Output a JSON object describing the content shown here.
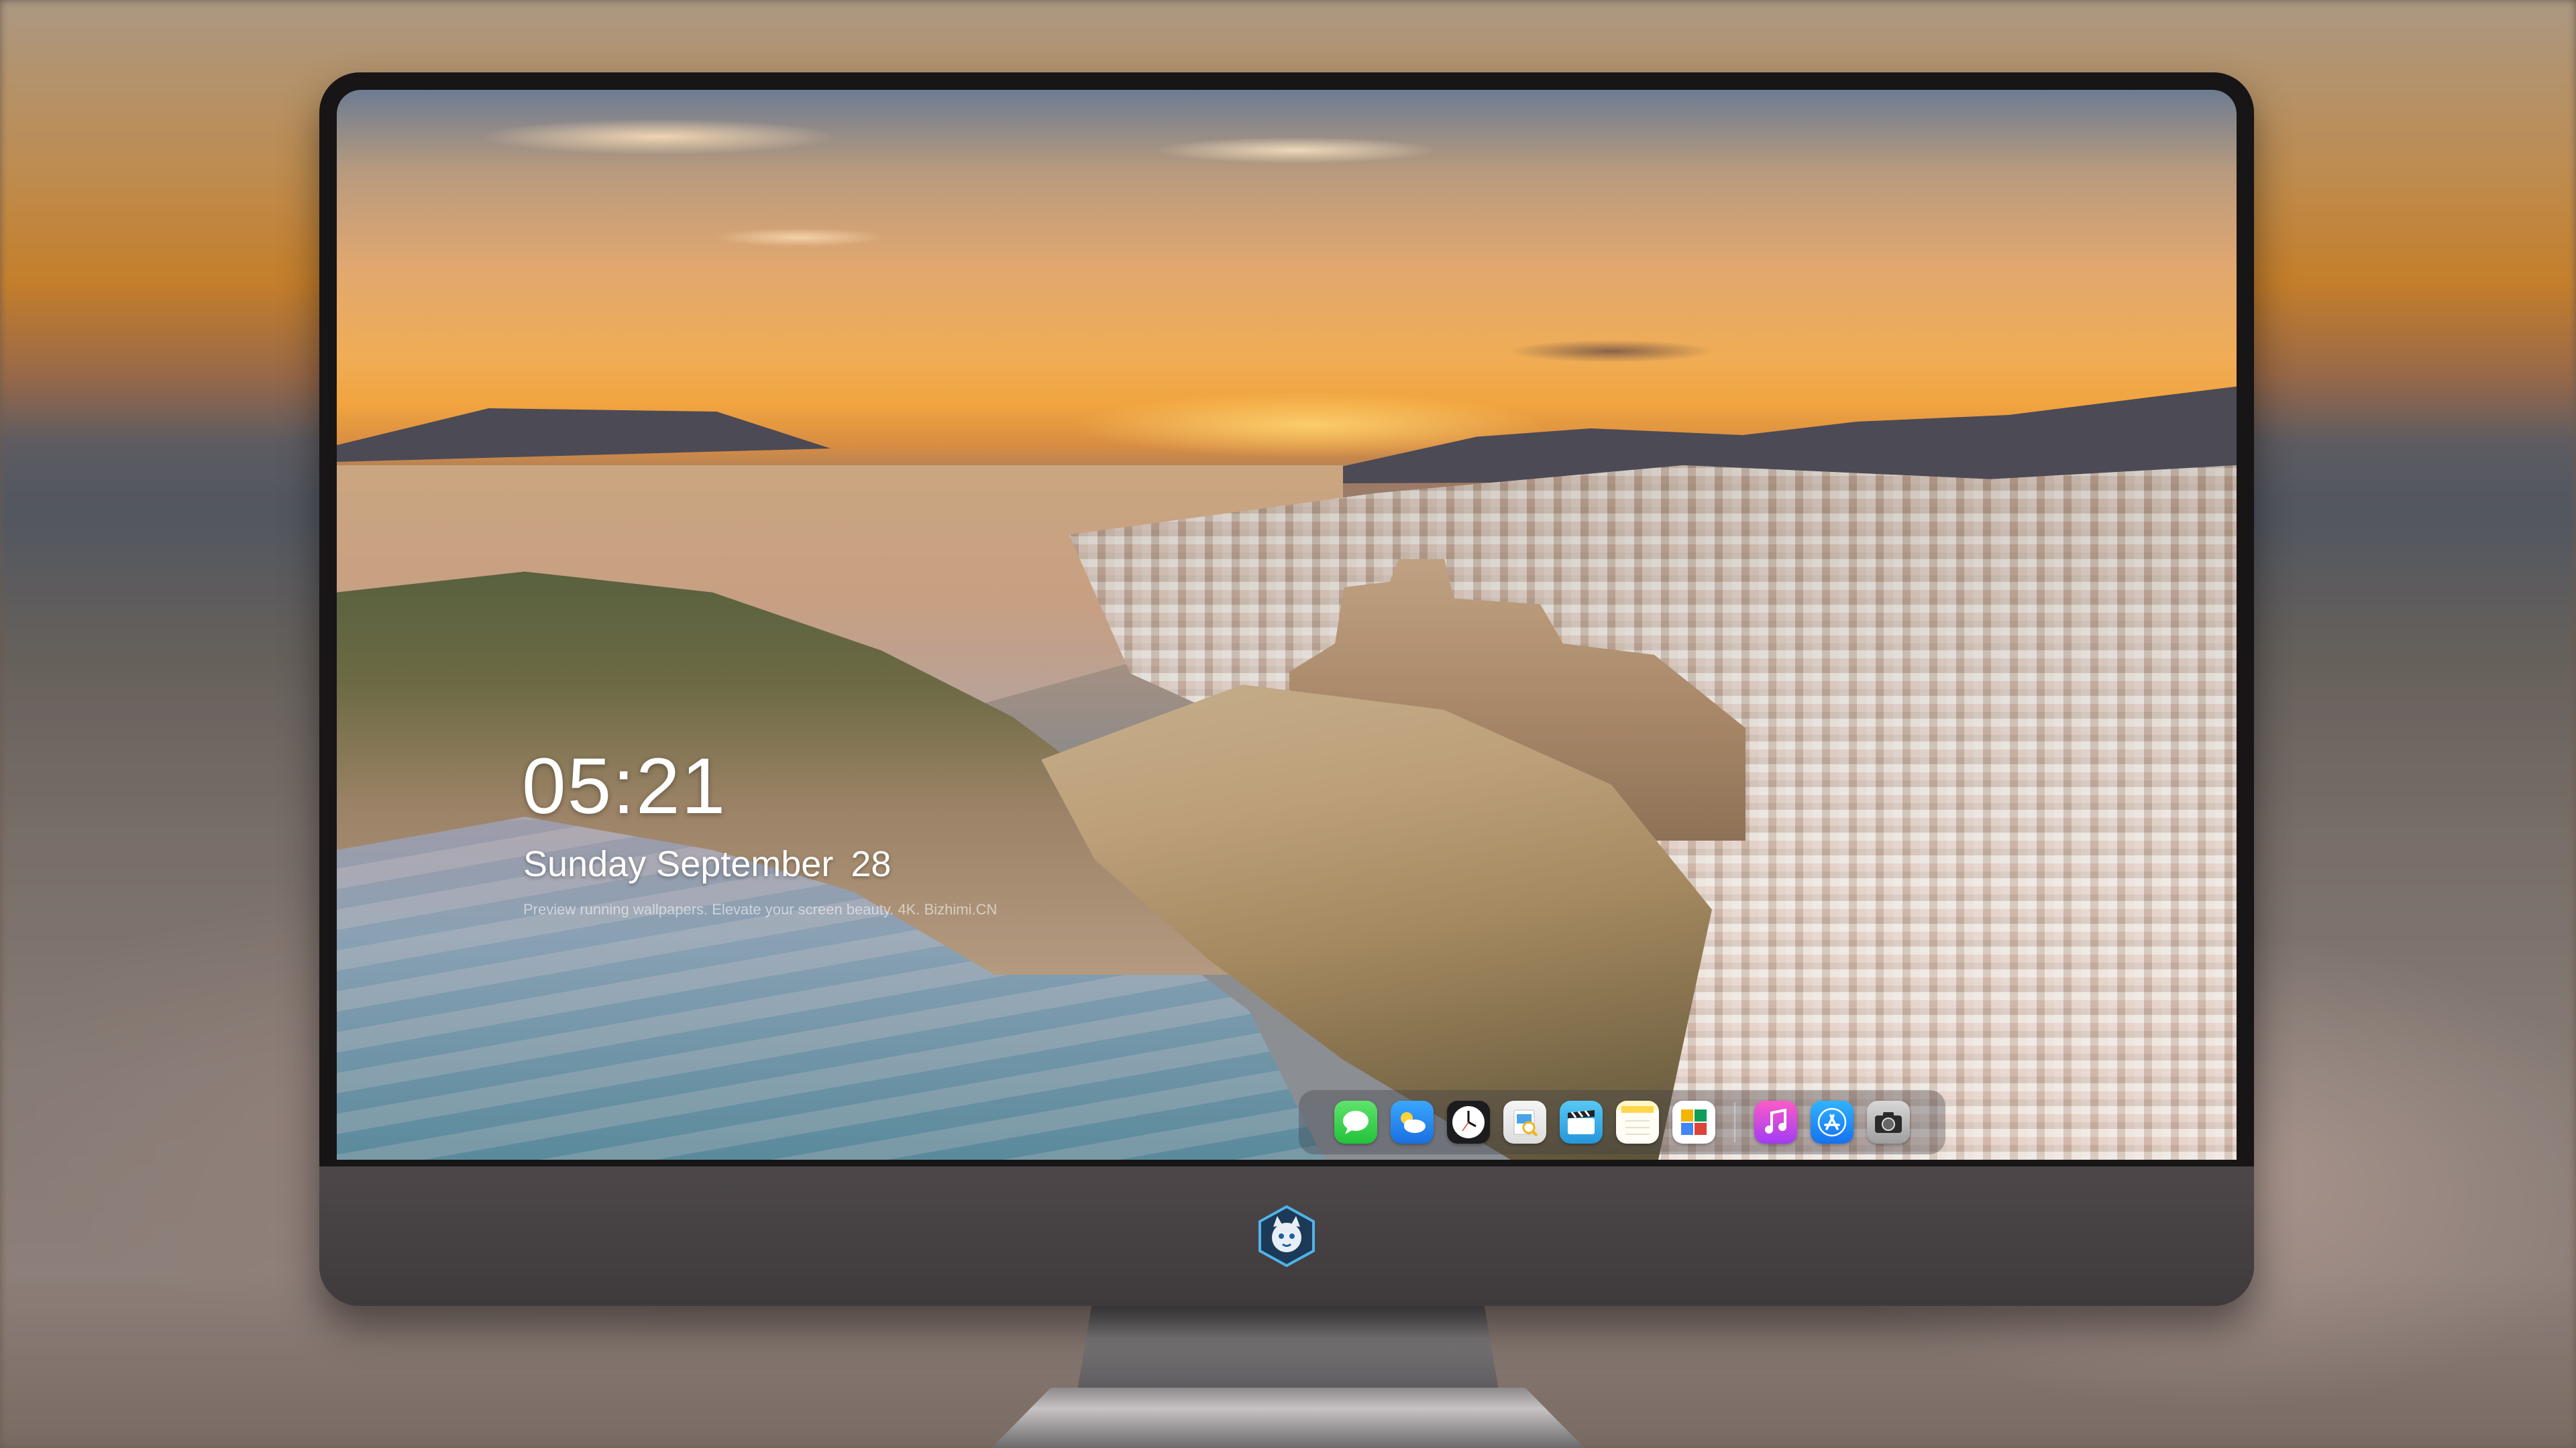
{
  "lockscreen": {
    "time": "05:21",
    "weekday": "Sunday",
    "month": "September",
    "day": "28",
    "caption": "Preview running wallpapers. Elevate your screen beauty. 4K. Bizhimi.CN"
  },
  "dock": {
    "left_icons": [
      {
        "name": "messages-icon"
      },
      {
        "name": "weather-icon"
      },
      {
        "name": "clock-icon"
      },
      {
        "name": "preview-icon"
      },
      {
        "name": "clips-icon"
      },
      {
        "name": "notes-icon"
      },
      {
        "name": "photos-icon"
      }
    ],
    "right_icons": [
      {
        "name": "music-icon"
      },
      {
        "name": "app-store-icon"
      },
      {
        "name": "camera-icon"
      }
    ]
  },
  "colors": {
    "sky_gold": "#f1a43f",
    "bezel": "#171516",
    "chin": "#4d4749"
  }
}
